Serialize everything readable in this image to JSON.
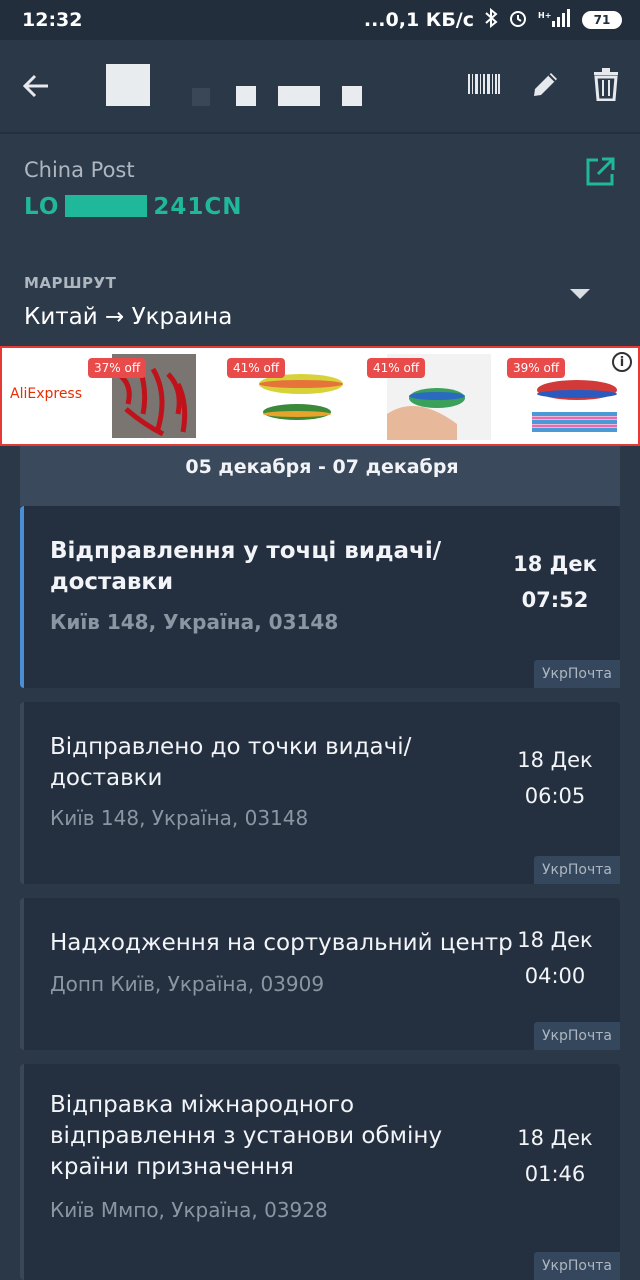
{
  "status_bar": {
    "time": "12:32",
    "network_speed": "...0,1 КБ/с",
    "battery": "71"
  },
  "app_bar": {
    "icons": [
      "arrow-back-icon",
      "barcode-icon",
      "edit-icon",
      "delete-icon"
    ]
  },
  "shipment": {
    "carrier": "China Post",
    "tracking_prefix": "LO",
    "tracking_suffix": "241CN",
    "route_label": "МАРШРУТ",
    "route_value": "Китай → Украина"
  },
  "ad": {
    "brand": "AliExpress",
    "items": [
      {
        "discount": "37% off"
      },
      {
        "discount": "41% off"
      },
      {
        "discount": "41% off"
      },
      {
        "discount": "39% off"
      }
    ]
  },
  "events": {
    "date_range": "05 декабря - 07 декабря",
    "items": [
      {
        "title": "Відправлення у точці видачі/ доставки",
        "location": "Київ 148, Україна, 03148",
        "date": "18 Дек",
        "time": "07:52",
        "carrier": "УкрПочта"
      },
      {
        "title": "Відправлено до точки видачі/ доставки",
        "location": "Київ 148, Україна, 03148",
        "date": "18 Дек",
        "time": "06:05",
        "carrier": "УкрПочта"
      },
      {
        "title": "Надходження на сортувальний центр",
        "location": "Допп Київ, Україна, 03909",
        "date": "18 Дек",
        "time": "04:00",
        "carrier": "УкрПочта"
      },
      {
        "title": "Відправка міжнародного відправлення з установи обміну країни призначення",
        "location": "Київ Ммпо, Україна, 03928",
        "date": "18 Дек",
        "time": "01:46",
        "carrier": "УкрПочта"
      }
    ]
  },
  "colors": {
    "background": "#2b3848",
    "accent_green": "#1fb89a",
    "active_border": "#4a8ed6",
    "ad_border": "#e53935"
  }
}
